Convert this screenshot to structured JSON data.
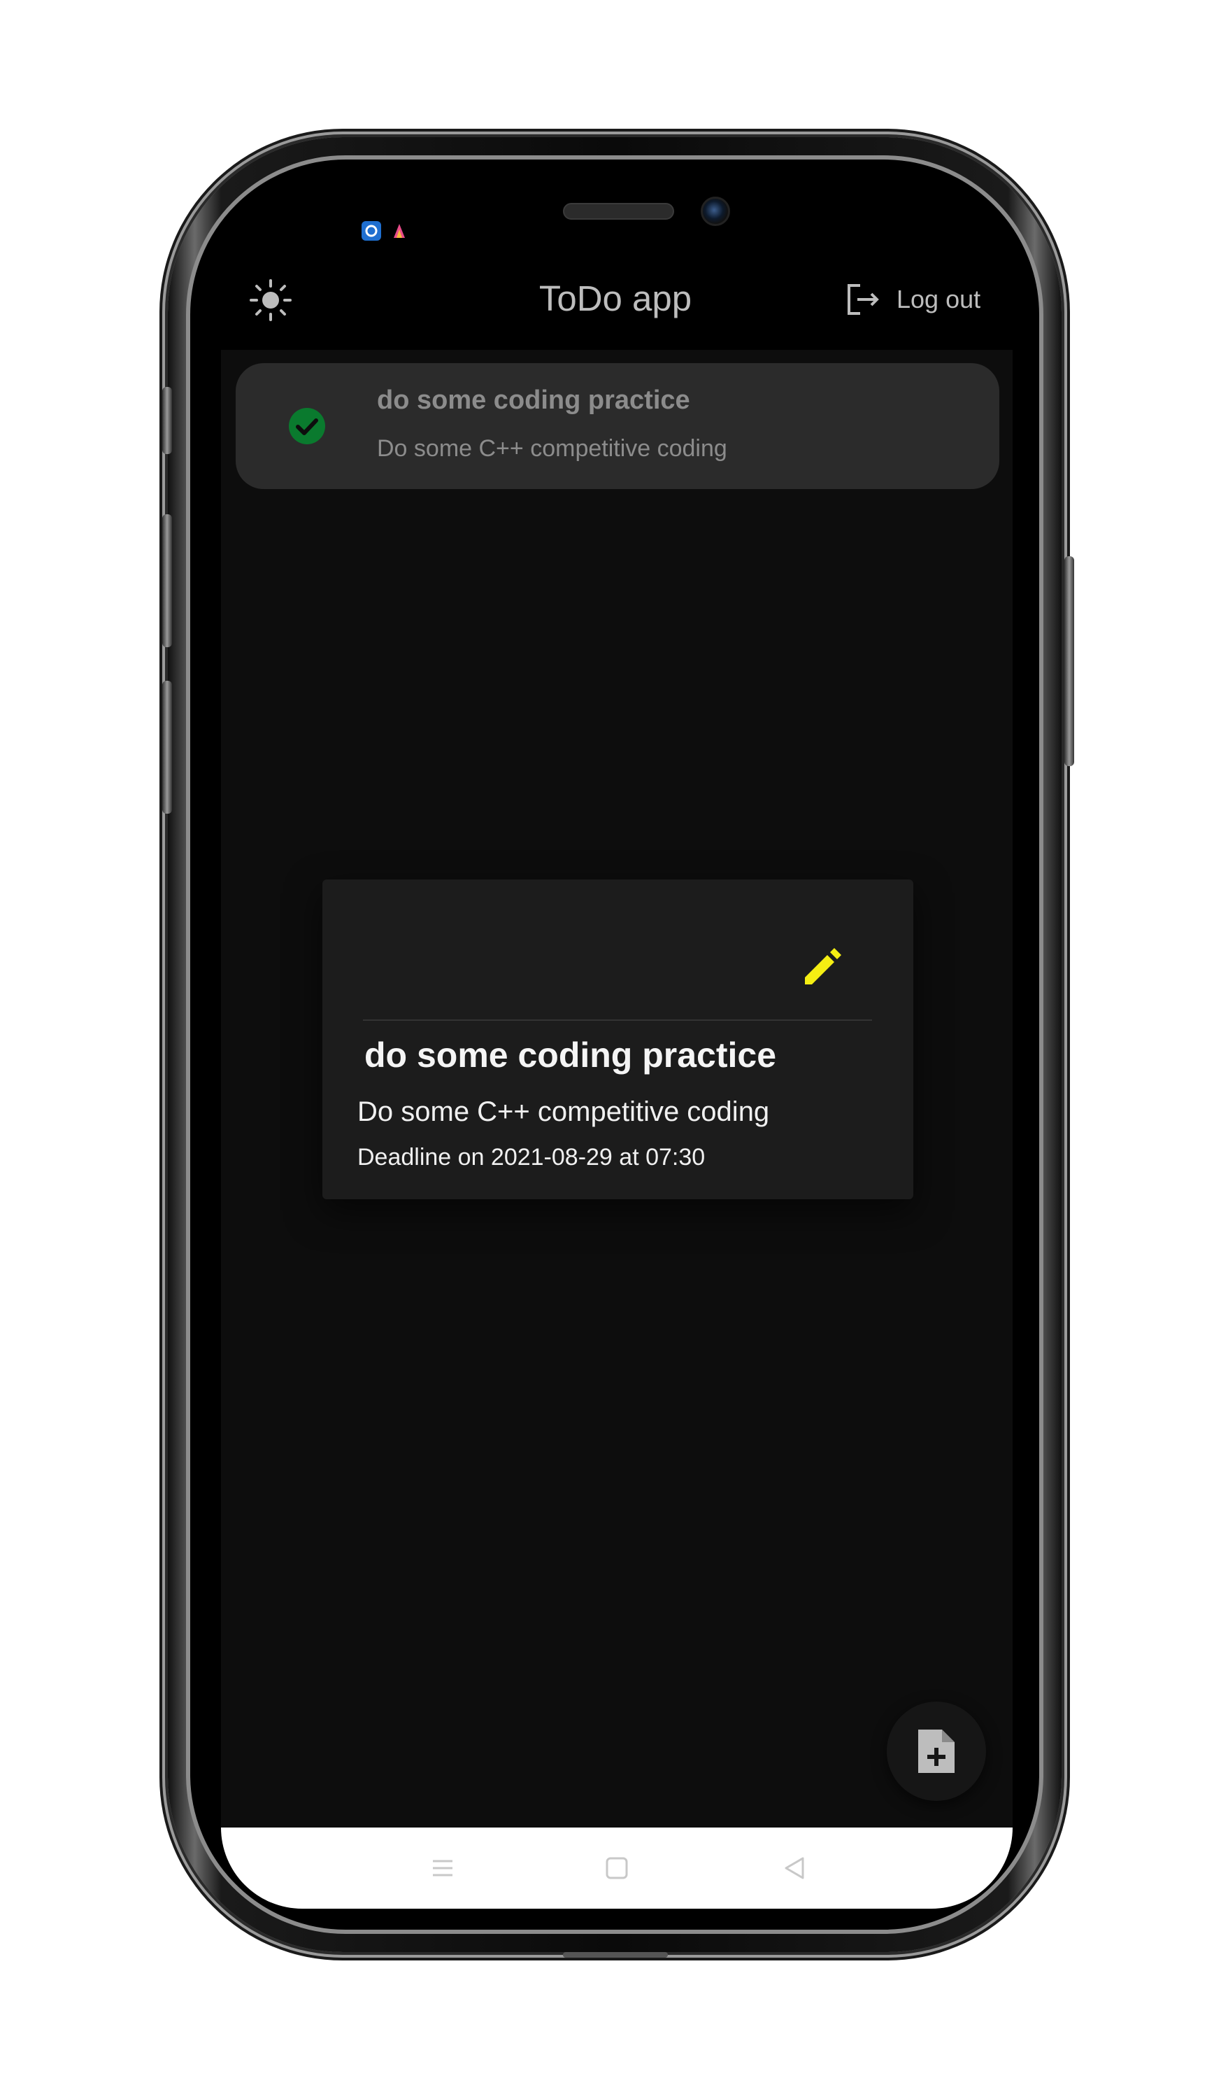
{
  "header": {
    "title": "ToDo app",
    "logout_label": "Log out"
  },
  "todo_list": [
    {
      "title": "do some coding practice",
      "subtitle": "Do some C++ competitive coding",
      "done": true
    }
  ],
  "dialog": {
    "title": "do some coding practice",
    "description": "Do some C++ competitive coding",
    "deadline": "Deadline on 2021-08-29 at 07:30"
  },
  "colors": {
    "screen_bg": "#0d0d0d",
    "card_bg": "#2b2b2b",
    "dialog_bg": "#1c1c1c",
    "check_green": "#0a7a2e",
    "edit_yellow": "#f5ee13"
  },
  "icons": {
    "theme_toggle": "sun-icon",
    "logout": "logout-icon",
    "done": "check-circle-icon",
    "edit": "pencil-icon",
    "add": "note-add-icon"
  }
}
